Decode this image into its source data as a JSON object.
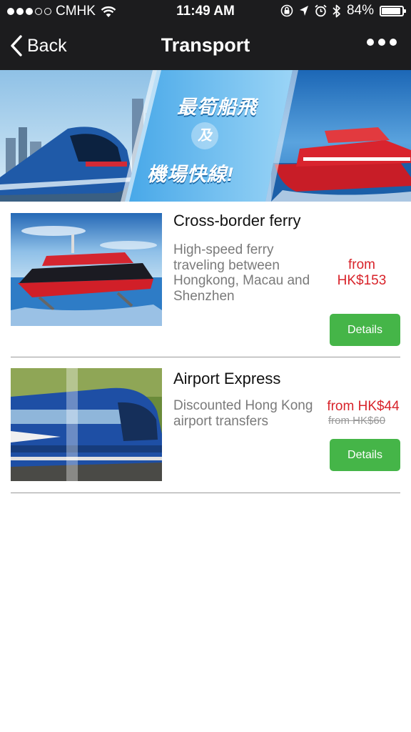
{
  "status_bar": {
    "carrier": "CMHK",
    "time": "11:49 AM",
    "battery": "84%",
    "battery_level": 0.84,
    "signal_bars": 3,
    "signal_total": 5
  },
  "nav": {
    "back_label": "Back",
    "title": "Transport"
  },
  "banner": {
    "slogan_line1": "最筍船飛",
    "slogan_connector": "及",
    "slogan_line2": "機場快線!"
  },
  "items": [
    {
      "name": "Cross-border ferry",
      "description": "High-speed ferry traveling between Hongkong, Macau and Shenzhen",
      "price_line1": "from",
      "price_line2": "HK$153",
      "button_label": "Details"
    },
    {
      "name": "Airport Express",
      "description": "Discounted Hong Kong airport transfers",
      "price": "from HK$44",
      "original_price": "from HK$60",
      "button_label": "Details"
    }
  ],
  "colors": {
    "nav_bg": "#1c1c1e",
    "price_red": "#d8232a",
    "button_green": "#45b548"
  }
}
